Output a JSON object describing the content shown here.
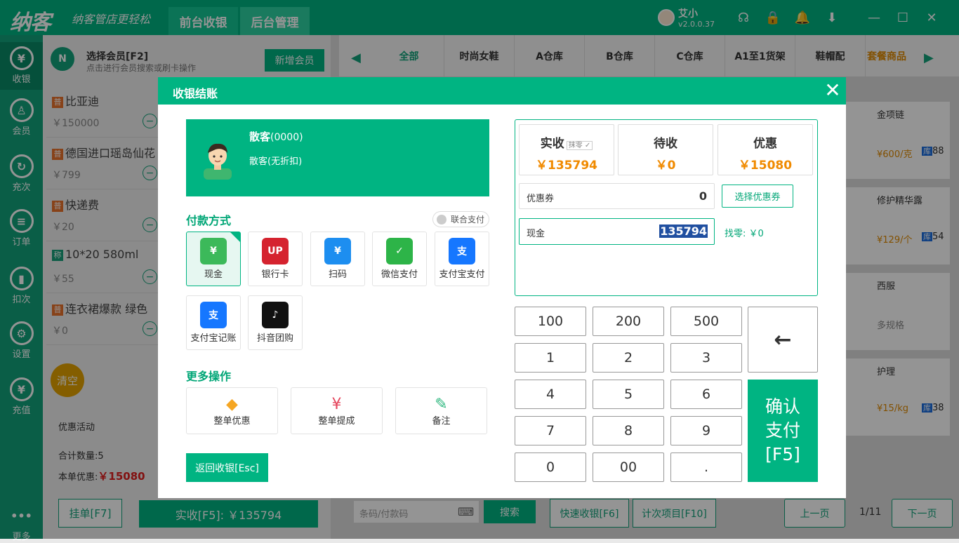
{
  "app": {
    "logo": "纳客",
    "slogan": "纳客管店更轻松",
    "tabs": [
      "前台收银",
      "后台管理"
    ],
    "user_name": "艾小",
    "version": "v2.0.0.37"
  },
  "sidebar": [
    {
      "label": "收银",
      "icon": "cash-register-icon",
      "glyph": "¥"
    },
    {
      "label": "会员",
      "icon": "member-icon",
      "glyph": "♙"
    },
    {
      "label": "充次",
      "icon": "recharge-count-icon",
      "glyph": "↻"
    },
    {
      "label": "订单",
      "icon": "order-icon",
      "glyph": "≡"
    },
    {
      "label": "扣次",
      "icon": "deduct-icon",
      "glyph": "▮"
    },
    {
      "label": "设置",
      "icon": "settings-icon",
      "glyph": "⚙"
    },
    {
      "label": "充值",
      "icon": "topup-icon",
      "glyph": "¥"
    },
    {
      "label": "更多",
      "icon": "more-icon",
      "glyph": "•••"
    }
  ],
  "member": {
    "title": "选择会员[F2]",
    "hint": "点击进行会员搜索或刷卡操作",
    "add_btn": "新增会员"
  },
  "cart": [
    {
      "tag": "普",
      "name": "比亚迪",
      "price": "￥150000"
    },
    {
      "tag": "普",
      "name": "德国进口瑶岛仙花",
      "price": "￥799"
    },
    {
      "tag": "普",
      "name": "快递费",
      "price": "￥20"
    },
    {
      "tag": "称",
      "name": "10*20 580ml",
      "price": "￥55"
    },
    {
      "tag": "普",
      "name": "连衣裙爆款 绿色",
      "price": "￥0"
    }
  ],
  "left_bottom": {
    "clear": "清空",
    "promo": "优惠活动",
    "qty_label": "合计数量:",
    "qty": "5",
    "discount_label": "本单优惠:",
    "discount": "￥15080",
    "hang_btn": "挂单[F7]",
    "pay_btn": "实收[F5]: ￥135794"
  },
  "categories": [
    "全部",
    "时尚女鞋",
    "A仓库",
    "B仓库",
    "C仓库",
    "A1至1货架",
    "鞋帽配",
    "套餐商品"
  ],
  "products": [
    {
      "name": "金项链",
      "price": "¥600/克",
      "stock_tag": "库",
      "stock": "88"
    },
    {
      "name": "修护精华露",
      "price": "¥129/个",
      "stock_tag": "库",
      "stock": "54"
    },
    {
      "name": "西服",
      "price": "多规格",
      "stock_tag": "",
      "stock": ""
    },
    {
      "name": "护理",
      "price": "¥15/kg",
      "stock_tag": "库",
      "stock": "38"
    }
  ],
  "bottom_bar": {
    "barcode_placeholder": "条码/付款码",
    "search": "搜索",
    "quick": "快速收银[F6]",
    "count": "计次项目[F10]",
    "prev": "上一页",
    "page": "1/11",
    "next": "下一页"
  },
  "modal": {
    "title": "收银结账",
    "customer": {
      "name": "散客",
      "code": "(0000)",
      "discount": "散客(无折扣)"
    },
    "pay_title": "付款方式",
    "combo": "联合支付",
    "payments": [
      {
        "label": "现金",
        "color": "#3cb95a",
        "glyph": "¥"
      },
      {
        "label": "银行卡",
        "color": "#d5232f",
        "glyph": "UP"
      },
      {
        "label": "扫码",
        "color": "#1d8ef0",
        "glyph": "¥"
      },
      {
        "label": "微信支付",
        "color": "#2db448",
        "glyph": "✓"
      },
      {
        "label": "支付宝支付",
        "color": "#1677ff",
        "glyph": "支"
      },
      {
        "label": "支付宝记账",
        "color": "#1677ff",
        "glyph": "支"
      },
      {
        "label": "抖音团购",
        "color": "#111111",
        "glyph": "♪"
      }
    ],
    "more_title": "更多操作",
    "more": [
      {
        "label": "整单优惠",
        "glyph": "◆",
        "color": "#f5a623"
      },
      {
        "label": "整单提成",
        "glyph": "¥",
        "color": "#e5455c"
      },
      {
        "label": "备注",
        "glyph": "✎",
        "color": "#2db77e"
      }
    ],
    "back": "返回收银[Esc]",
    "received_label": "实收",
    "round_label": "抹零",
    "received": "￥135794",
    "pending_label": "待收",
    "pending": "￥0",
    "discount_label": "优惠",
    "discount": "￥15080",
    "coupon_label": "优惠券",
    "coupon_value": "0",
    "coupon_btn": "选择优惠券",
    "cash_label": "现金",
    "cash_value": "135794",
    "change": "找零: ￥0",
    "keys": [
      [
        "100",
        "200",
        "500"
      ],
      [
        "1",
        "2",
        "3"
      ],
      [
        "4",
        "5",
        "6"
      ],
      [
        "7",
        "8",
        "9"
      ],
      [
        "0",
        "00",
        "."
      ]
    ],
    "backspace": "←",
    "confirm": [
      "确认",
      "支付",
      "[F5]"
    ]
  }
}
